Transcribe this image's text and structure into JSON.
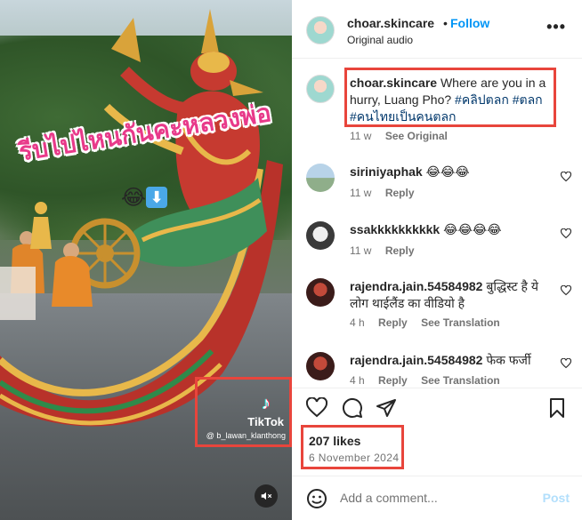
{
  "video": {
    "overlay_text": "รีบไปไหนกันคะหลวงพ่อ",
    "overlay_emoji": "😂",
    "overlay_arrow": "⬇",
    "watermark_brand": "TikTok",
    "watermark_user": "@ b_lawan_klanthong",
    "mute_icon": "speaker-muted-icon"
  },
  "header": {
    "username": "choar.skincare",
    "separator": "•",
    "follow_label": "Follow",
    "audio_label": "Original audio",
    "more_icon": "more-options-icon"
  },
  "caption": {
    "username": "choar.skincare",
    "text": "Where are you in a hurry, Luang Pho?",
    "hashtags": [
      "#คลิปตลก",
      "#ตลก",
      "#คนไทยเป็นคนตลก"
    ],
    "time": "11 w",
    "see_original": "See Original"
  },
  "comments": [
    {
      "username": "siriniyaphak",
      "text": "😂😂😂",
      "time": "11 w",
      "reply": "Reply",
      "translation": ""
    },
    {
      "username": "ssakkkkkkkkkk",
      "text": "😂😂😂😂",
      "time": "11 w",
      "reply": "Reply",
      "translation": ""
    },
    {
      "username": "rajendra.jain.54584982",
      "text": "बुद्धिस्ट है ये लोग थाईलैंड का वीडियो है",
      "time": "4 h",
      "reply": "Reply",
      "translation": "See Translation"
    },
    {
      "username": "rajendra.jain.54584982",
      "text": "फेक फर्जी",
      "time": "4 h",
      "reply": "Reply",
      "translation": "See Translation"
    }
  ],
  "actions": {
    "like_icon": "heart-icon",
    "comment_icon": "comment-icon",
    "share_icon": "share-icon",
    "save_icon": "bookmark-icon"
  },
  "stats": {
    "likes": "207 likes",
    "date": "6 November 2024"
  },
  "composer": {
    "placeholder": "Add a comment...",
    "post_label": "Post",
    "emoji_icon": "emoji-icon"
  },
  "colors": {
    "accent": "#0095f6",
    "highlight_box": "#e8453c",
    "hashtag": "#00376b",
    "muted_text": "#737373",
    "post_disabled": "#b2dffc"
  }
}
